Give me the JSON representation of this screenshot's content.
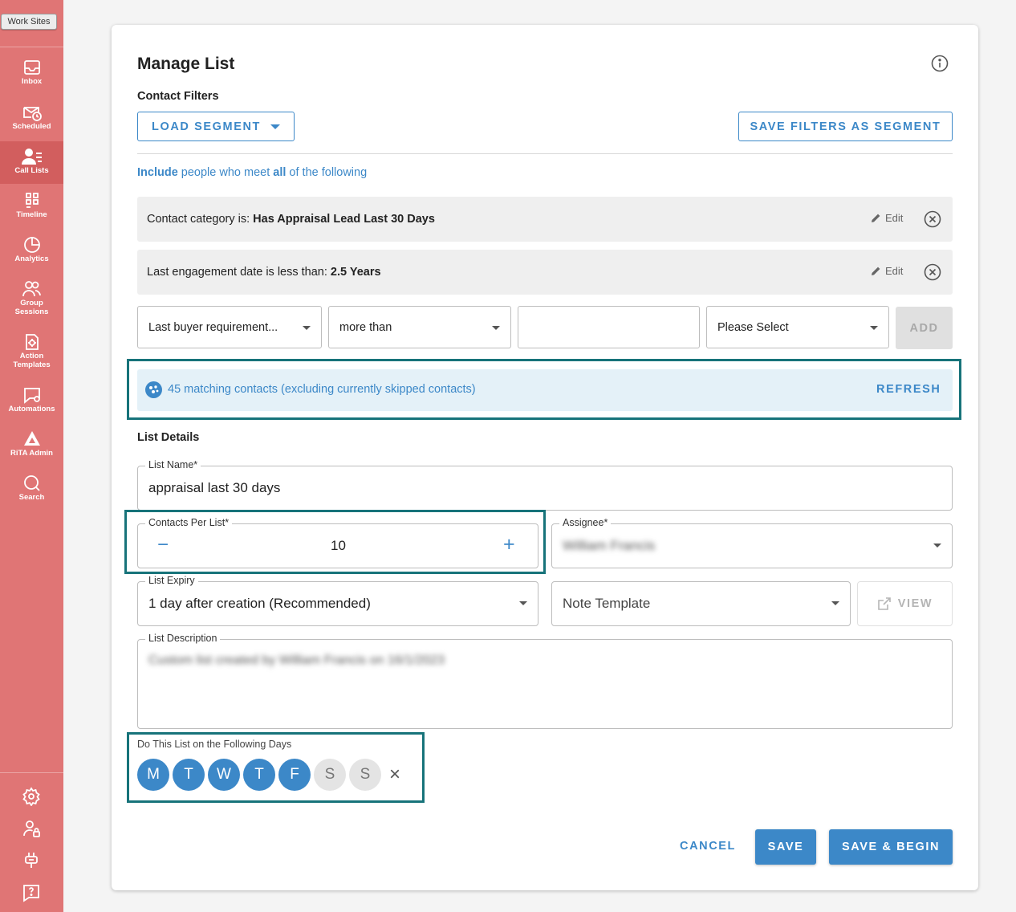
{
  "sidebar": {
    "worksites_label": "Work Sites",
    "items": [
      {
        "label": "Inbox",
        "icon": "inbox-icon"
      },
      {
        "label": "Scheduled",
        "icon": "scheduled-icon"
      },
      {
        "label": "Call Lists",
        "icon": "call-lists-icon",
        "active": true
      },
      {
        "label": "Timeline",
        "icon": "timeline-icon"
      },
      {
        "label": "Analytics",
        "icon": "analytics-icon"
      },
      {
        "label": "Group Sessions",
        "icon": "group-sessions-icon"
      },
      {
        "label": "Action Templates",
        "icon": "action-templates-icon"
      },
      {
        "label": "Automations",
        "icon": "automations-icon"
      },
      {
        "label": "RiTA Admin",
        "icon": "rita-admin-icon"
      },
      {
        "label": "Search",
        "icon": "search-icon"
      }
    ],
    "bottom_icons": [
      "settings-icon",
      "user-lock-icon",
      "plug-icon",
      "help-icon"
    ]
  },
  "dialog": {
    "title": "Manage List",
    "contact_filters_heading": "Contact Filters",
    "load_segment_label": "LOAD SEGMENT",
    "save_filters_label": "SAVE FILTERS AS SEGMENT",
    "include_line": {
      "part1": "Include",
      "part2": "people who meet",
      "part3": "all",
      "part4": "of the following"
    },
    "filters": [
      {
        "prefix": "Contact category is:",
        "value": "Has Appraisal Lead Last 30 Days",
        "edit_label": "Edit"
      },
      {
        "prefix": "Last engagement date is less than:",
        "value": "2.5 Years",
        "edit_label": "Edit"
      }
    ],
    "new_filter": {
      "field": "Last buyer requirement...",
      "operator": "more than",
      "value": "",
      "unit": "Please Select",
      "add_label": "ADD"
    },
    "matching": {
      "text": "45 matching contacts (excluding currently skipped contacts)",
      "refresh_label": "REFRESH"
    },
    "list_details_heading": "List Details",
    "list_name": {
      "label": "List Name",
      "required": "*",
      "value": "appraisal last 30 days"
    },
    "contacts_per_list": {
      "label": "Contacts Per List",
      "required": "*",
      "value": "10",
      "minus": "−",
      "plus": "+"
    },
    "assignee": {
      "label": "Assignee",
      "required": "*",
      "value": "William Francis"
    },
    "list_expiry": {
      "label": "List Expiry",
      "value": "1 day after creation (Recommended)"
    },
    "note_template": {
      "placeholder": "Note Template",
      "view_label": "VIEW"
    },
    "list_description": {
      "label": "List Description",
      "value": "Custom list created by William Francis on 16/1/2023"
    },
    "days": {
      "label": "Do This List on the Following Days",
      "items": [
        {
          "letter": "M",
          "selected": true
        },
        {
          "letter": "T",
          "selected": true
        },
        {
          "letter": "W",
          "selected": true
        },
        {
          "letter": "T",
          "selected": true
        },
        {
          "letter": "F",
          "selected": true
        },
        {
          "letter": "S",
          "selected": false
        },
        {
          "letter": "S",
          "selected": false
        }
      ],
      "clear": "×"
    },
    "actions": {
      "cancel": "CANCEL",
      "save": "SAVE",
      "save_begin": "SAVE & BEGIN"
    }
  },
  "colors": {
    "sidebar": "#e07575",
    "accent": "#3c88c8",
    "highlight": "#17737a"
  }
}
